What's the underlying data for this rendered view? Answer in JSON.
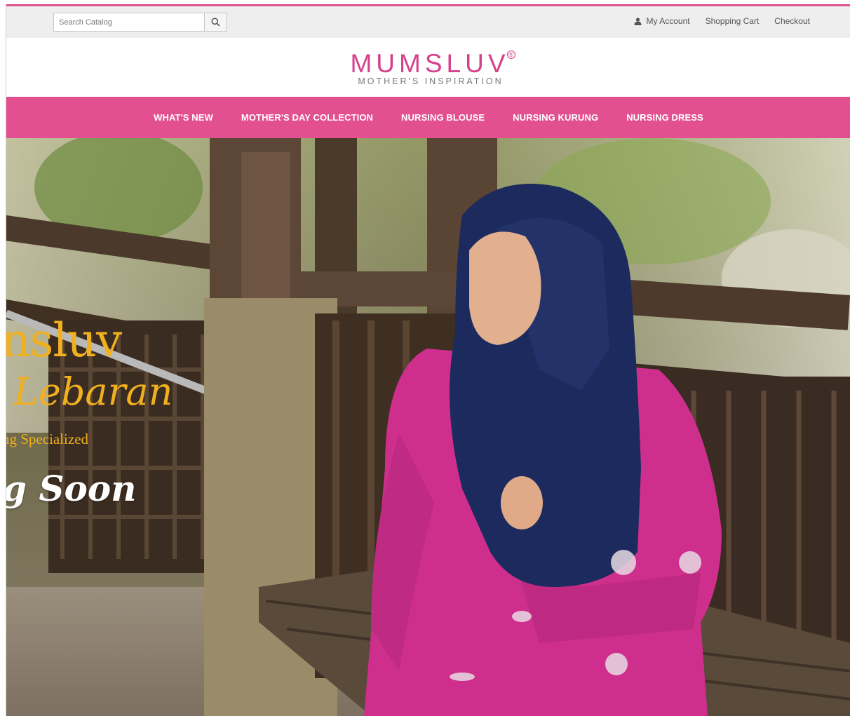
{
  "search": {
    "placeholder": "Search Catalog",
    "value": "",
    "button_icon": "search-icon"
  },
  "account_links": [
    {
      "label": "My Account",
      "icon": "person-icon"
    },
    {
      "label": "Shopping Cart"
    },
    {
      "label": "Checkout"
    }
  ],
  "logo": {
    "main": "MUMSLUV",
    "registered": "®",
    "tagline": "MOTHER'S INSPIRATION"
  },
  "nav": [
    {
      "label": "WHAT'S NEW"
    },
    {
      "label": "MOTHER'S DAY COLLECTION"
    },
    {
      "label": "NURSING BLOUSE"
    },
    {
      "label": "NURSING KURUNG"
    },
    {
      "label": "NURSING DRESS"
    }
  ],
  "hero": {
    "line1": "nsluv",
    "line2": "Lebaran",
    "line3": "ng Specialized",
    "line4": "g Soon"
  },
  "colors": {
    "brand_pink": "#e2508f",
    "logo_pink": "#d6418b",
    "hero_gold": "#f0b020",
    "topbar_bg": "#eeeeee"
  }
}
